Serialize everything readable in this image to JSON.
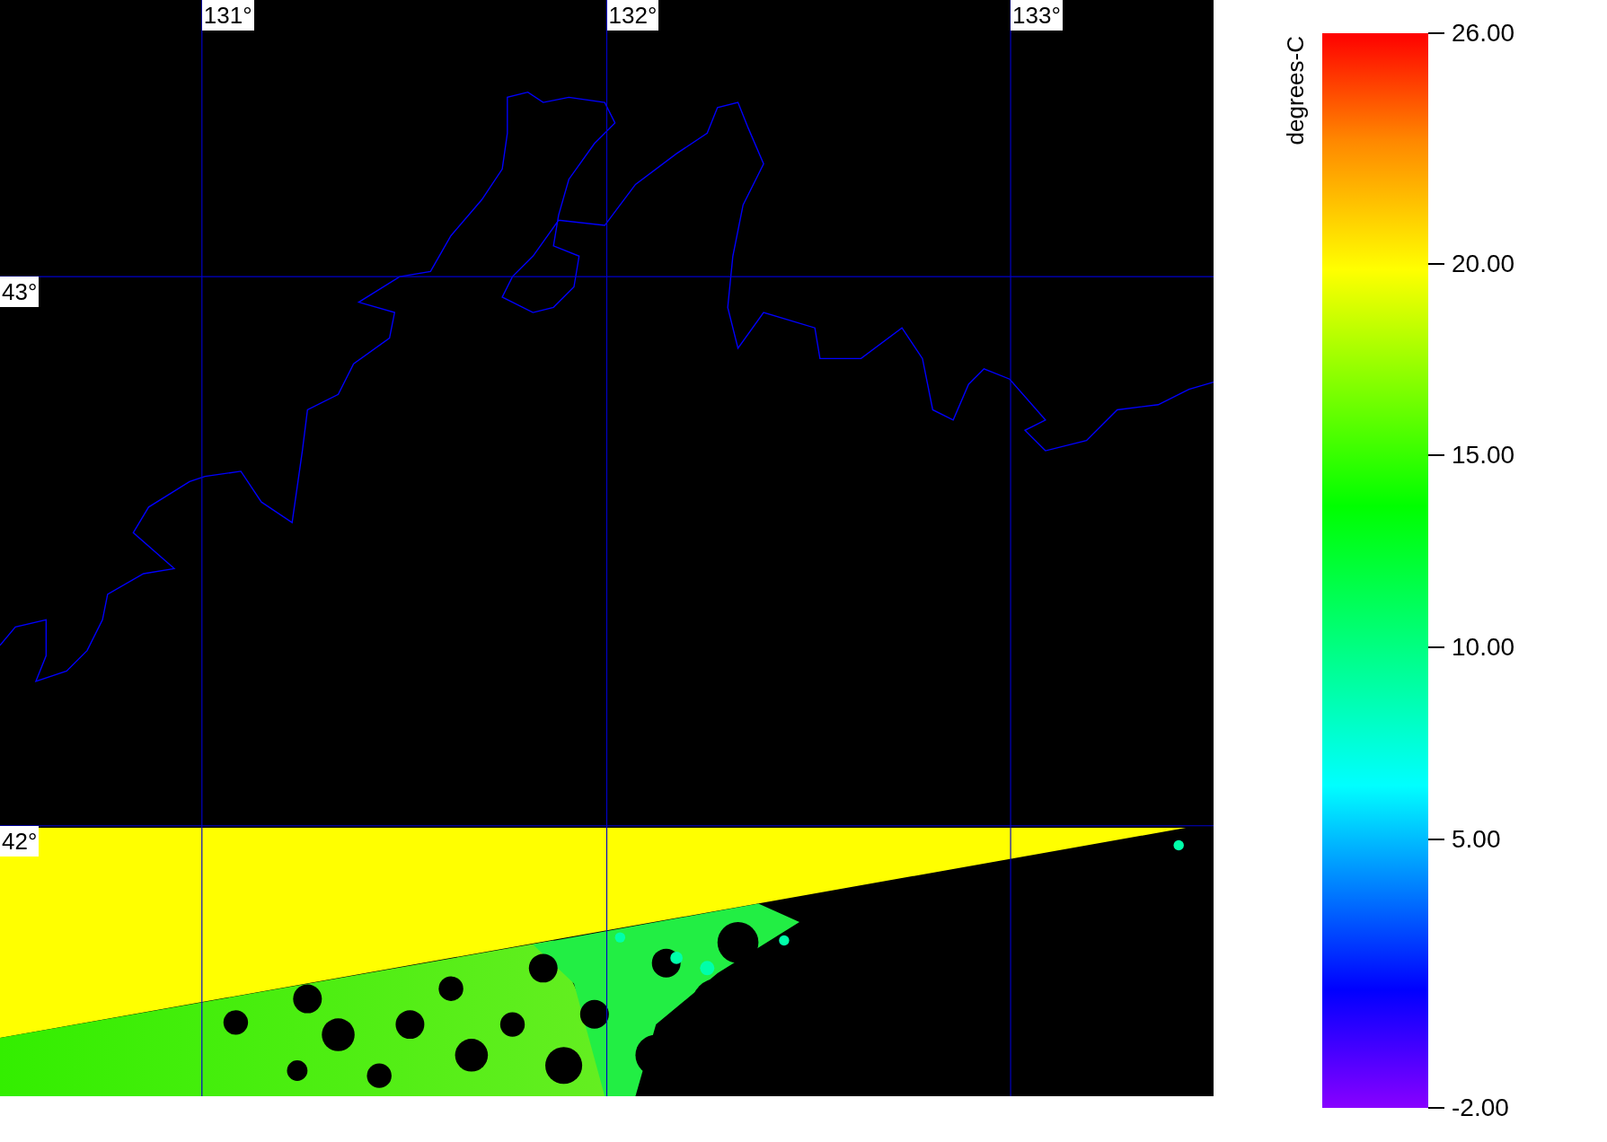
{
  "map": {
    "longitude_labels": [
      "131°",
      "132°",
      "133°"
    ],
    "latitude_labels": [
      "43°",
      "42°"
    ]
  },
  "legend": {
    "title": "degrees-C",
    "ticks": [
      "26.00",
      "20.00",
      "15.00",
      "10.00",
      "5.00",
      "-2.00"
    ]
  }
}
